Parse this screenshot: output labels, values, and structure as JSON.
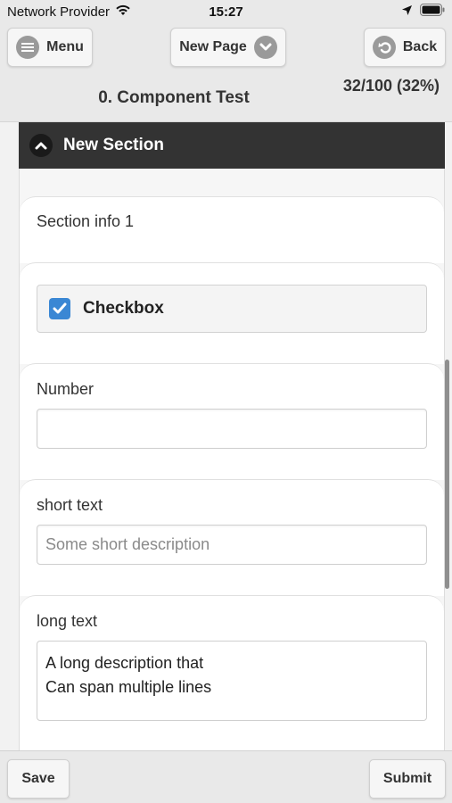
{
  "status_bar": {
    "carrier": "Network Provider",
    "time": "15:27"
  },
  "header": {
    "menu_label": "Menu",
    "page_label": "New Page",
    "back_label": "Back",
    "title": "0. Component Test",
    "progress": "32/100 (32%)"
  },
  "section": {
    "title": "New Section",
    "info": "Section info 1",
    "checkbox": {
      "label": "Checkbox",
      "checked": true
    },
    "number": {
      "label": "Number",
      "value": ""
    },
    "short_text": {
      "label": "short text",
      "placeholder": "Some short description",
      "value": ""
    },
    "long_text": {
      "label": "long text",
      "value": "A long description that\nCan span multiple lines"
    }
  },
  "footer": {
    "save_label": "Save",
    "submit_label": "Submit"
  },
  "colors": {
    "section_header_bg": "#333333",
    "checkbox_accent": "#3a87d4",
    "bar_bg": "#e9e9e9"
  },
  "icons": [
    "wifi-icon",
    "location-arrow-icon",
    "battery-icon",
    "menu-icon",
    "chevron-down-icon",
    "back-arrow-icon",
    "chevron-up-icon",
    "checkmark-icon"
  ]
}
